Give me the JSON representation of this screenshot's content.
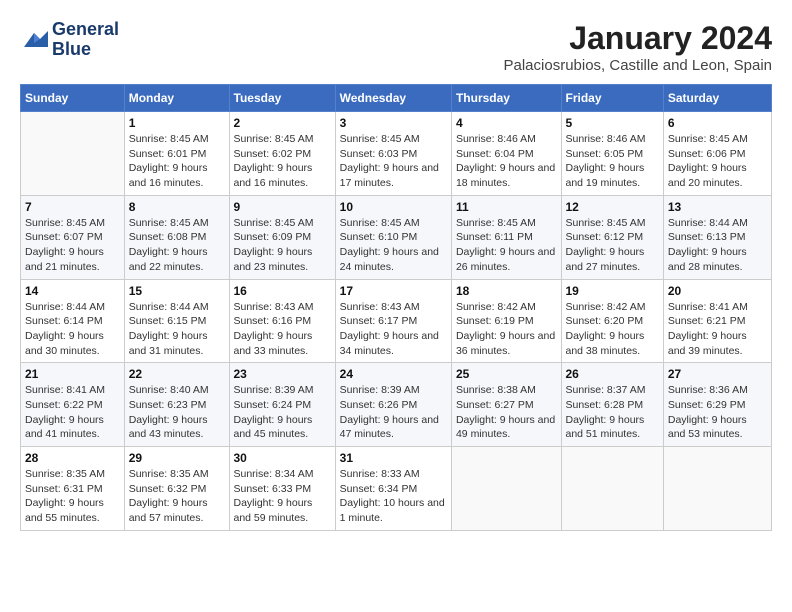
{
  "logo": {
    "line1": "General",
    "line2": "Blue"
  },
  "title": "January 2024",
  "subtitle": "Palaciosrubios, Castille and Leon, Spain",
  "days_of_week": [
    "Sunday",
    "Monday",
    "Tuesday",
    "Wednesday",
    "Thursday",
    "Friday",
    "Saturday"
  ],
  "weeks": [
    [
      {
        "day": "",
        "sunrise": "",
        "sunset": "",
        "daylight": ""
      },
      {
        "day": "1",
        "sunrise": "Sunrise: 8:45 AM",
        "sunset": "Sunset: 6:01 PM",
        "daylight": "Daylight: 9 hours and 16 minutes."
      },
      {
        "day": "2",
        "sunrise": "Sunrise: 8:45 AM",
        "sunset": "Sunset: 6:02 PM",
        "daylight": "Daylight: 9 hours and 16 minutes."
      },
      {
        "day": "3",
        "sunrise": "Sunrise: 8:45 AM",
        "sunset": "Sunset: 6:03 PM",
        "daylight": "Daylight: 9 hours and 17 minutes."
      },
      {
        "day": "4",
        "sunrise": "Sunrise: 8:46 AM",
        "sunset": "Sunset: 6:04 PM",
        "daylight": "Daylight: 9 hours and 18 minutes."
      },
      {
        "day": "5",
        "sunrise": "Sunrise: 8:46 AM",
        "sunset": "Sunset: 6:05 PM",
        "daylight": "Daylight: 9 hours and 19 minutes."
      },
      {
        "day": "6",
        "sunrise": "Sunrise: 8:45 AM",
        "sunset": "Sunset: 6:06 PM",
        "daylight": "Daylight: 9 hours and 20 minutes."
      }
    ],
    [
      {
        "day": "7",
        "sunrise": "Sunrise: 8:45 AM",
        "sunset": "Sunset: 6:07 PM",
        "daylight": "Daylight: 9 hours and 21 minutes."
      },
      {
        "day": "8",
        "sunrise": "Sunrise: 8:45 AM",
        "sunset": "Sunset: 6:08 PM",
        "daylight": "Daylight: 9 hours and 22 minutes."
      },
      {
        "day": "9",
        "sunrise": "Sunrise: 8:45 AM",
        "sunset": "Sunset: 6:09 PM",
        "daylight": "Daylight: 9 hours and 23 minutes."
      },
      {
        "day": "10",
        "sunrise": "Sunrise: 8:45 AM",
        "sunset": "Sunset: 6:10 PM",
        "daylight": "Daylight: 9 hours and 24 minutes."
      },
      {
        "day": "11",
        "sunrise": "Sunrise: 8:45 AM",
        "sunset": "Sunset: 6:11 PM",
        "daylight": "Daylight: 9 hours and 26 minutes."
      },
      {
        "day": "12",
        "sunrise": "Sunrise: 8:45 AM",
        "sunset": "Sunset: 6:12 PM",
        "daylight": "Daylight: 9 hours and 27 minutes."
      },
      {
        "day": "13",
        "sunrise": "Sunrise: 8:44 AM",
        "sunset": "Sunset: 6:13 PM",
        "daylight": "Daylight: 9 hours and 28 minutes."
      }
    ],
    [
      {
        "day": "14",
        "sunrise": "Sunrise: 8:44 AM",
        "sunset": "Sunset: 6:14 PM",
        "daylight": "Daylight: 9 hours and 30 minutes."
      },
      {
        "day": "15",
        "sunrise": "Sunrise: 8:44 AM",
        "sunset": "Sunset: 6:15 PM",
        "daylight": "Daylight: 9 hours and 31 minutes."
      },
      {
        "day": "16",
        "sunrise": "Sunrise: 8:43 AM",
        "sunset": "Sunset: 6:16 PM",
        "daylight": "Daylight: 9 hours and 33 minutes."
      },
      {
        "day": "17",
        "sunrise": "Sunrise: 8:43 AM",
        "sunset": "Sunset: 6:17 PM",
        "daylight": "Daylight: 9 hours and 34 minutes."
      },
      {
        "day": "18",
        "sunrise": "Sunrise: 8:42 AM",
        "sunset": "Sunset: 6:19 PM",
        "daylight": "Daylight: 9 hours and 36 minutes."
      },
      {
        "day": "19",
        "sunrise": "Sunrise: 8:42 AM",
        "sunset": "Sunset: 6:20 PM",
        "daylight": "Daylight: 9 hours and 38 minutes."
      },
      {
        "day": "20",
        "sunrise": "Sunrise: 8:41 AM",
        "sunset": "Sunset: 6:21 PM",
        "daylight": "Daylight: 9 hours and 39 minutes."
      }
    ],
    [
      {
        "day": "21",
        "sunrise": "Sunrise: 8:41 AM",
        "sunset": "Sunset: 6:22 PM",
        "daylight": "Daylight: 9 hours and 41 minutes."
      },
      {
        "day": "22",
        "sunrise": "Sunrise: 8:40 AM",
        "sunset": "Sunset: 6:23 PM",
        "daylight": "Daylight: 9 hours and 43 minutes."
      },
      {
        "day": "23",
        "sunrise": "Sunrise: 8:39 AM",
        "sunset": "Sunset: 6:24 PM",
        "daylight": "Daylight: 9 hours and 45 minutes."
      },
      {
        "day": "24",
        "sunrise": "Sunrise: 8:39 AM",
        "sunset": "Sunset: 6:26 PM",
        "daylight": "Daylight: 9 hours and 47 minutes."
      },
      {
        "day": "25",
        "sunrise": "Sunrise: 8:38 AM",
        "sunset": "Sunset: 6:27 PM",
        "daylight": "Daylight: 9 hours and 49 minutes."
      },
      {
        "day": "26",
        "sunrise": "Sunrise: 8:37 AM",
        "sunset": "Sunset: 6:28 PM",
        "daylight": "Daylight: 9 hours and 51 minutes."
      },
      {
        "day": "27",
        "sunrise": "Sunrise: 8:36 AM",
        "sunset": "Sunset: 6:29 PM",
        "daylight": "Daylight: 9 hours and 53 minutes."
      }
    ],
    [
      {
        "day": "28",
        "sunrise": "Sunrise: 8:35 AM",
        "sunset": "Sunset: 6:31 PM",
        "daylight": "Daylight: 9 hours and 55 minutes."
      },
      {
        "day": "29",
        "sunrise": "Sunrise: 8:35 AM",
        "sunset": "Sunset: 6:32 PM",
        "daylight": "Daylight: 9 hours and 57 minutes."
      },
      {
        "day": "30",
        "sunrise": "Sunrise: 8:34 AM",
        "sunset": "Sunset: 6:33 PM",
        "daylight": "Daylight: 9 hours and 59 minutes."
      },
      {
        "day": "31",
        "sunrise": "Sunrise: 8:33 AM",
        "sunset": "Sunset: 6:34 PM",
        "daylight": "Daylight: 10 hours and 1 minute."
      },
      {
        "day": "",
        "sunrise": "",
        "sunset": "",
        "daylight": ""
      },
      {
        "day": "",
        "sunrise": "",
        "sunset": "",
        "daylight": ""
      },
      {
        "day": "",
        "sunrise": "",
        "sunset": "",
        "daylight": ""
      }
    ]
  ]
}
